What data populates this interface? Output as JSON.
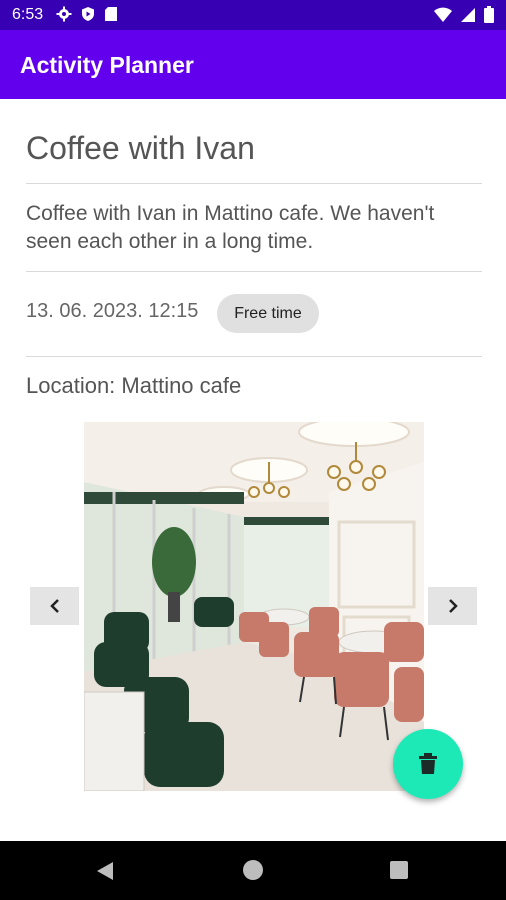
{
  "status_bar": {
    "time": "6:53",
    "icons_left": [
      "gear-icon",
      "shield-play-icon",
      "sd-card-icon"
    ],
    "icons_right": [
      "wifi-icon",
      "signal-icon",
      "battery-icon"
    ]
  },
  "app_bar": {
    "title": "Activity Planner"
  },
  "activity": {
    "title": "Coffee with Ivan",
    "description": "Coffee with Ivan in Mattino cafe. We haven't seen each other in a long time.",
    "datetime": "13. 06. 2023. 12:15",
    "category_chip": "Free time",
    "location": "Location: Mattino cafe"
  },
  "gallery": {
    "prev_icon": "chevron-left-icon",
    "next_icon": "chevron-right-icon",
    "image_subject": "cafe interior photo"
  },
  "fab": {
    "icon": "trash-icon",
    "color": "#1de9b6"
  },
  "colors": {
    "status_bar": "#3700b3",
    "app_bar": "#6200ee",
    "accent": "#1de9b6"
  }
}
